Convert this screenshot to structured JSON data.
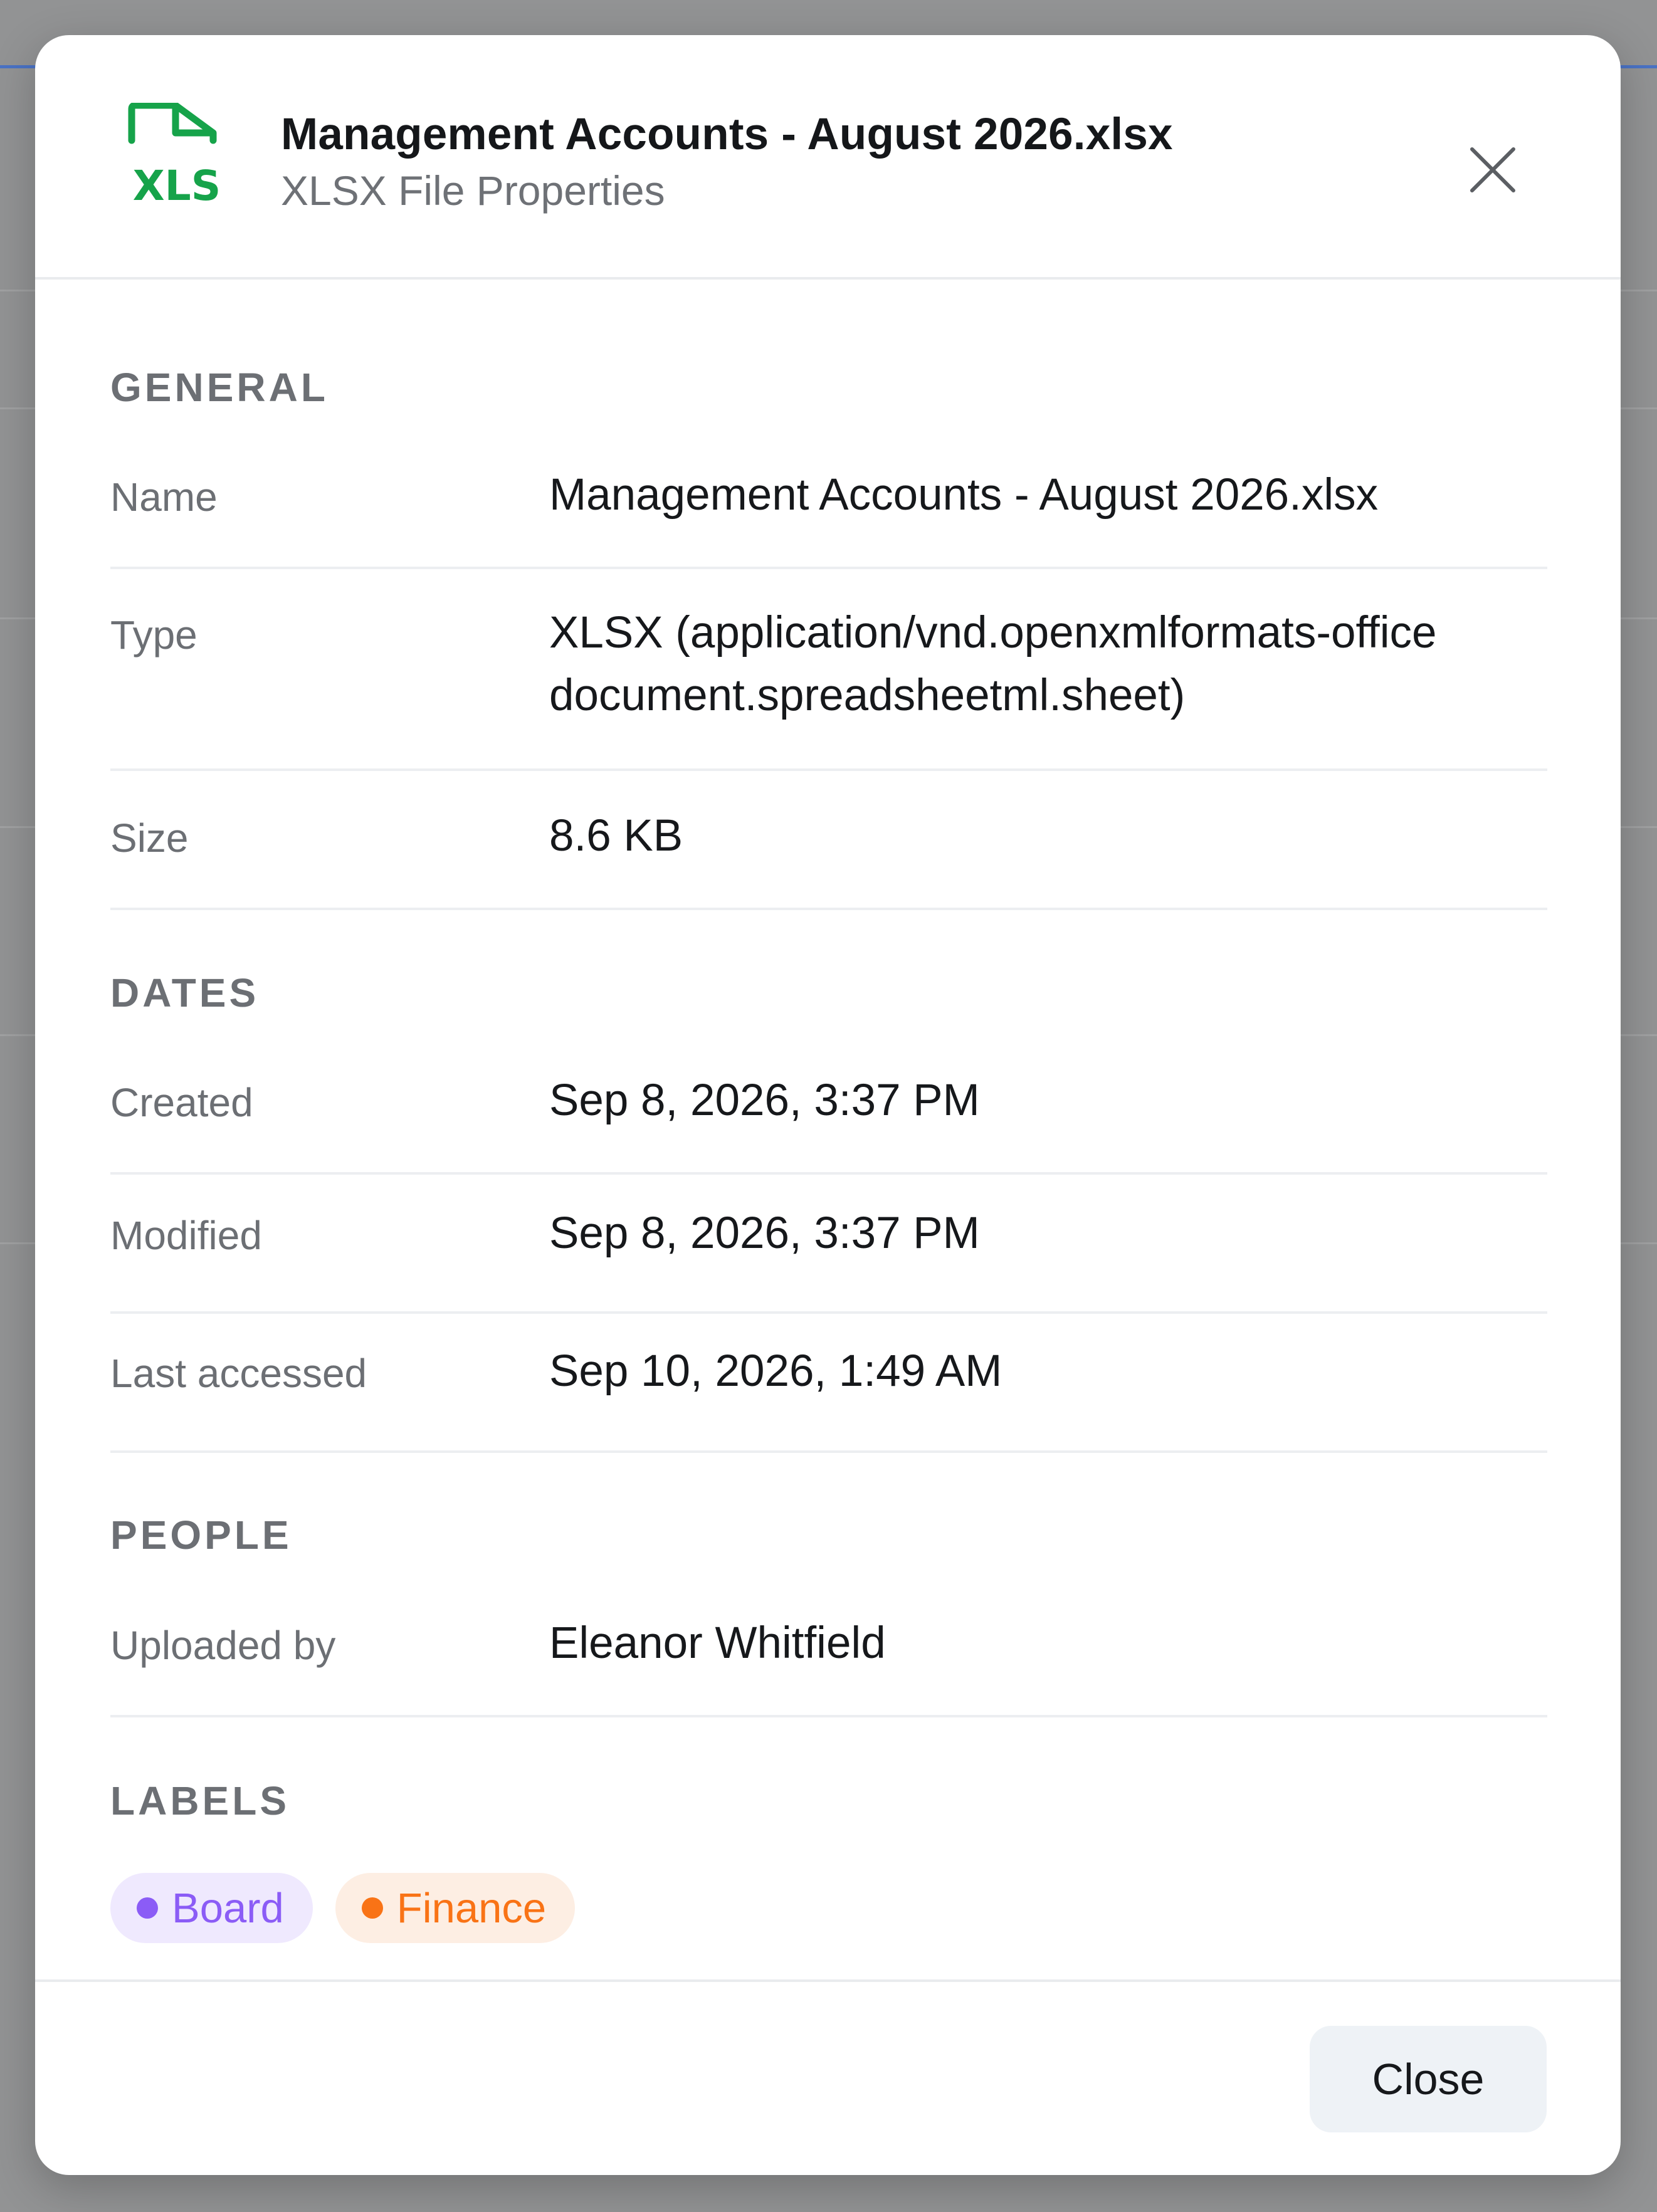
{
  "dialog": {
    "file_icon_text": "XLS",
    "title": "Management Accounts - August 2026.xlsx",
    "subtitle": "XLSX File Properties",
    "close_label": "Close"
  },
  "general": {
    "heading": "GENERAL",
    "name": {
      "label": "Name",
      "value": "Management Accounts - August 2026.xlsx"
    },
    "type": {
      "label": "Type",
      "value_line1": "XLSX (application/vnd.openxmlformats-office",
      "value_line2": "document.spreadsheetml.sheet)"
    },
    "size": {
      "label": "Size",
      "value": "8.6 KB"
    }
  },
  "dates": {
    "heading": "DATES",
    "created": {
      "label": "Created",
      "value": "Sep 8, 2026, 3:37 PM"
    },
    "modified": {
      "label": "Modified",
      "value": "Sep 8, 2026, 3:37 PM"
    },
    "last_accessed": {
      "label": "Last accessed",
      "value": "Sep 10, 2026, 1:49 AM"
    }
  },
  "people": {
    "heading": "PEOPLE",
    "uploaded_by": {
      "label": "Uploaded by",
      "value": "Eleanor Whitfield"
    }
  },
  "labels": {
    "heading": "LABELS",
    "items": [
      {
        "text": "Board",
        "color": "#8b5cf6",
        "bg": "#efe9fe"
      },
      {
        "text": "Finance",
        "color": "#f97316",
        "bg": "#fdeee3"
      }
    ]
  },
  "colors": {
    "icon_green": "#16a34a",
    "overlay": "#929394"
  }
}
